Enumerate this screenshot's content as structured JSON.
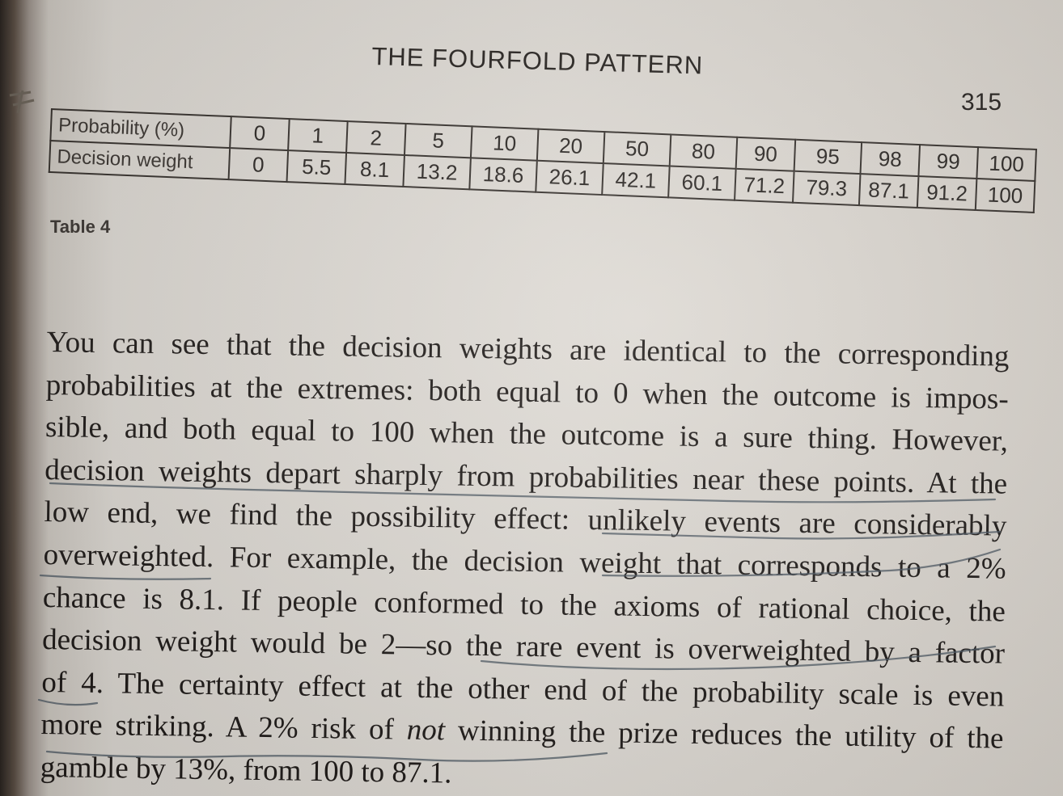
{
  "header": {
    "running_head": "THE FOURFOLD PATTERN",
    "page_number": "315"
  },
  "table": {
    "row_labels": [
      "Probability (%)",
      "Decision weight"
    ],
    "probabilities": [
      "0",
      "1",
      "2",
      "5",
      "10",
      "20",
      "50",
      "80",
      "90",
      "95",
      "98",
      "99",
      "100"
    ],
    "decision_weights": [
      "0",
      "5.5",
      "8.1",
      "13.2",
      "18.6",
      "26.1",
      "42.1",
      "60.1",
      "71.2",
      "79.3",
      "87.1",
      "91.2",
      "100"
    ],
    "caption": "Table 4"
  },
  "body": {
    "lines": [
      "You can see that the decision weights are identical to the corresponding",
      "probabilities at the extremes: both equal to 0 when the outcome is impos-",
      "sible, and both equal to 100 when the outcome is a sure thing. However,",
      "decision weights depart sharply from probabilities near these points. At the",
      "low end, we find the possibility effect: unlikely events are considerably",
      "overweighted. For example, the decision weight that corresponds to a 2%",
      "chance is 8.1. If people conformed to the axioms of rational choice, the",
      "decision weight would be 2—so the rare event is overweighted by a factor",
      "of 4. The certainty effect at the other end of the probability scale is even"
    ],
    "line_10_before": "more striking. A 2% risk of ",
    "line_10_emph": "not",
    "line_10_after": " winning the prize reduces the utility of the",
    "line_11": "gamble by 13%, from 100 to 87.1."
  },
  "colors": {
    "ink": "#1f1b19",
    "pencil": "#4a5560",
    "paper": "#dedad4"
  }
}
